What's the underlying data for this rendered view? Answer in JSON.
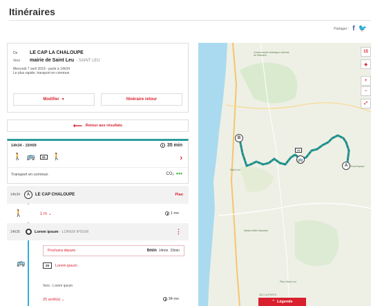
{
  "page": {
    "title": "Itinéraires"
  },
  "share": {
    "label": "Partager :",
    "facebook": "f",
    "twitter": "🐦"
  },
  "search": {
    "from_label": "De",
    "from": "LE CAP LA CHALOUPE",
    "to_label": "Vers",
    "to": "mairie de Saint Leu",
    "to_city": "- SAINT LEU",
    "date_line": "Mercredi 7 avril 2019 - partir à 14h34",
    "mode_line": "Le plus rapide, transport en commun",
    "modify_label": "Modifier",
    "return_label": "Itinéraire retour"
  },
  "back": {
    "label": "Retour aux résultats"
  },
  "trip": {
    "time_range": "14h34 - 15H09",
    "duration": "35 min",
    "line": "41",
    "mode": "Transport en commun",
    "co2_label": "CO₂",
    "co2_rating": "♦♦♦"
  },
  "steps": {
    "start_time": "14h34",
    "start_marker": "A",
    "start_name": "LE CAP CHALOUPE",
    "plan_label": "Plan",
    "walk_dist": "1 m",
    "walk_dur": "1 mn",
    "stop_time": "14h35",
    "stop_name": "Lorem ipsum",
    "stop_city": "- LOREM IPSUM",
    "departures_label": "Prochains départs",
    "dep_first": "6min",
    "dep_second": "14min",
    "dep_third": "23min",
    "line_number": "29",
    "line_name": "Lorem ipsum",
    "towards": "Vers : Lorem ipsum",
    "stops_count": "25 arrêt(s)",
    "ride_dur": "34 mn"
  },
  "map": {
    "zoom_level": "15",
    "start_pin": "A",
    "end_pin": "B",
    "bus_line": "41",
    "labels": {
      "conservatoire": "Conservatoire botanique national de Mascarin",
      "saint_leu": "Saint-Leu",
      "maison_belle": "Maison Belle Mascarin",
      "piton": "Piton Saint-Leu",
      "zac": "ZAC LA PORTE",
      "terra": "Terra Espace"
    },
    "legend_label": "Légende"
  }
}
